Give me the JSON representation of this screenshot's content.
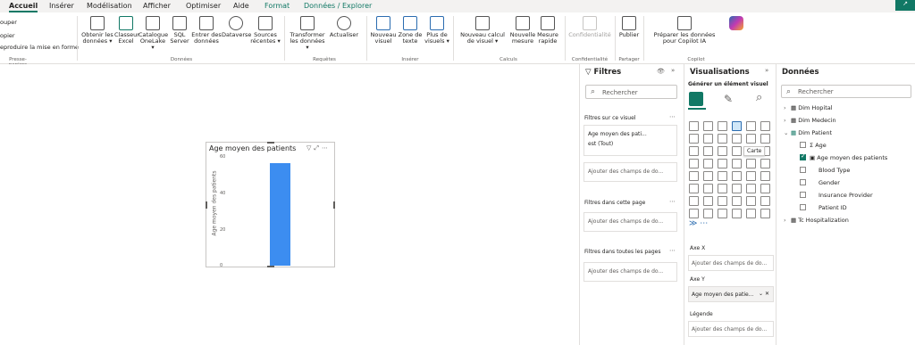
{
  "ribbon_tabs": [
    "Accueil",
    "Insérer",
    "Modélisation",
    "Afficher",
    "Optimiser",
    "Aide",
    "Format",
    "Données / Explorer"
  ],
  "clipboard": {
    "items": [
      "ouper",
      "opier",
      "eproduire la mise en forme"
    ],
    "group": "Presse-papiers"
  },
  "ribbon": {
    "donnees": {
      "group": "Données",
      "items": [
        "Obtenir les données",
        "Classeur Excel",
        "Catalogue OneLake",
        "SQL Server",
        "Entrer des données",
        "Dataverse",
        "Sources récentes"
      ]
    },
    "requetes": {
      "group": "Requêtes",
      "items": [
        "Transformer les données",
        "Actualiser"
      ]
    },
    "inserer": {
      "group": "Insérer",
      "items": [
        "Nouveau visuel",
        "Zone de texte",
        "Plus de visuels"
      ]
    },
    "calculs": {
      "group": "Calculs",
      "items": [
        "Nouveau calcul de visuel",
        "Nouvelle mesure",
        "Mesure rapide"
      ]
    },
    "confidentialite": {
      "group": "Confidentialité",
      "items": [
        "Confidentialité"
      ]
    },
    "partager": {
      "group": "Partager",
      "items": [
        "Publier"
      ]
    },
    "copilot": {
      "group": "Copilot",
      "items": [
        "Préparer les données pour Copilot IA"
      ]
    }
  },
  "visual": {
    "title": "Age moyen des patients",
    "y_label": "Age moyen des patients",
    "y_ticks": [
      "60",
      "40",
      "20",
      "0"
    ]
  },
  "chart_data": {
    "type": "bar",
    "title": "Age moyen des patients",
    "ylabel": "Age moyen des patients",
    "categories": [
      ""
    ],
    "values": [
      57
    ],
    "ylim": [
      0,
      60
    ]
  },
  "filters": {
    "title": "Filtres",
    "search_placeholder": "Rechercher",
    "on_visual": "Filtres sur ce visuel",
    "field_name": "Age moyen des pati...",
    "field_state": "est (Tout)",
    "add_fields": "Ajouter des champs de do...",
    "on_page": "Filtres dans cette page",
    "on_all_pages": "Filtres dans toutes les pages"
  },
  "visualisations": {
    "title": "Visualisations",
    "subtitle": "Générer un élément visuel",
    "tooltip": "Carte",
    "axis_x_label": "Axe X",
    "axis_x_well": "Ajouter des champs de do...",
    "axis_y_label": "Axe Y",
    "axis_y_well": "Age moyen des patie...",
    "legend_label": "Légende",
    "legend_well": "Ajouter des champs de do..."
  },
  "data_pane": {
    "title": "Données",
    "search_placeholder": "Rechercher",
    "tables": [
      "Dim Hopital",
      "Dim Medecin",
      "Dim Patient",
      "Tc Hospitalization"
    ],
    "fields": [
      "Age",
      "Age moyen des patients",
      "Blood Type",
      "Gender",
      "Insurance Provider",
      "Patient ID"
    ],
    "checked_field": "Age moyen des patients"
  },
  "colors": {
    "accent": "#117865",
    "bar": "#3c8df0",
    "pane_bg": "#ffffff"
  }
}
